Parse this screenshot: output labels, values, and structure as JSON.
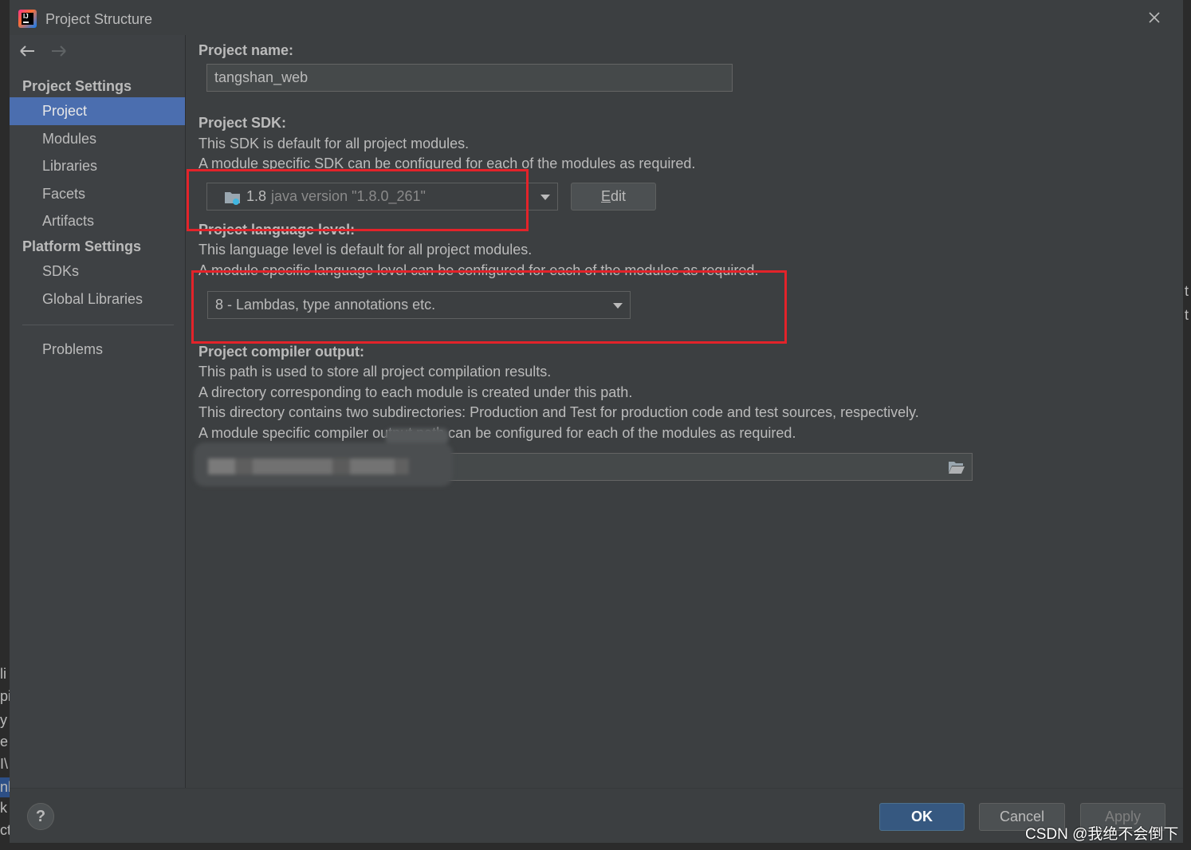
{
  "window": {
    "title": "Project Structure"
  },
  "icons": {
    "app": "intellij-idea-icon",
    "close": "close-icon",
    "back": "arrow-left-icon",
    "forward": "arrow-right-icon",
    "sdk": "jdk-folder-icon",
    "browse": "folder-open-icon",
    "dropdown": "chevron-down-icon",
    "help": "help-icon"
  },
  "sidebar": {
    "project_settings": {
      "header": "Project Settings",
      "items": [
        {
          "label": "Project",
          "selected": true
        },
        {
          "label": "Modules"
        },
        {
          "label": "Libraries"
        },
        {
          "label": "Facets"
        },
        {
          "label": "Artifacts"
        }
      ]
    },
    "platform_settings": {
      "header": "Platform Settings",
      "items": [
        {
          "label": "SDKs"
        },
        {
          "label": "Global Libraries"
        }
      ]
    },
    "problems": {
      "label": "Problems"
    }
  },
  "main": {
    "project_name": {
      "label": "Project name:",
      "value": "tangshan_web"
    },
    "project_sdk": {
      "label": "Project SDK:",
      "description": [
        "This SDK is default for all project modules.",
        "A module specific SDK can be configured for each of the modules as required."
      ],
      "selected_version": "1.8",
      "selected_detail": "java version \"1.8.0_261\"",
      "edit_label": "Edit"
    },
    "language_level": {
      "label": "Project language level:",
      "description": [
        "This language level is default for all project modules.",
        "A module specific language level can be configured for each of the modules as required."
      ],
      "selected": "8 - Lambdas, type annotations etc."
    },
    "compiler_output": {
      "label": "Project compiler output:",
      "description": [
        "This path is used to store all project compilation results.",
        "A directory corresponding to each module is created under this path.",
        "This directory contains two subdirectories: Production and Test for production code and test sources, respectively.",
        "A module specific compiler output path can be configured for each of the modules as required."
      ]
    }
  },
  "footer": {
    "help_label": "?",
    "ok_label": "OK",
    "cancel_label": "Cancel",
    "apply_label": "Apply",
    "apply_enabled": false
  },
  "watermark": "CSDN @我绝不会倒下",
  "background_window": {
    "left_fragments": [
      "li",
      "pi",
      "y",
      "e",
      "I\\",
      "nb",
      "k",
      "ct"
    ],
    "right_fragments": [
      "t",
      "t"
    ]
  },
  "colors": {
    "background": "#3c3f41",
    "text": "#bbbbbb",
    "selection": "#4b6eaf",
    "ok_button": "#365880",
    "annotation": "#e3232a"
  }
}
